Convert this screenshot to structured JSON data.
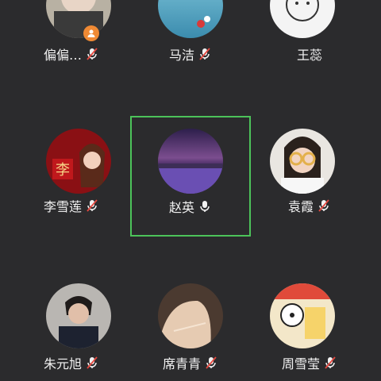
{
  "participants": [
    {
      "name": "偏偏…",
      "mic": "muted",
      "host": true
    },
    {
      "name": "马洁",
      "mic": "muted"
    },
    {
      "name": "王蕊",
      "mic": "none"
    },
    {
      "name": "李雪莲",
      "mic": "muted"
    },
    {
      "name": "赵英",
      "mic": "active",
      "speaking": true
    },
    {
      "name": "袁霞",
      "mic": "muted"
    },
    {
      "name": "朱元旭",
      "mic": "muted"
    },
    {
      "name": "席青青",
      "mic": "muted"
    },
    {
      "name": "周雪莹",
      "mic": "muted"
    }
  ],
  "avatar_tile": {
    "text": "李"
  },
  "colors": {
    "background": "#2b2b2d",
    "active_outline": "#4cc35a",
    "muted_slash": "#e5483f",
    "host_badge": "#f08a34",
    "name_text": "#f2f2f2"
  },
  "icons": {
    "muted": "mic-muted-icon",
    "active": "mic-icon",
    "host": "person-icon"
  }
}
